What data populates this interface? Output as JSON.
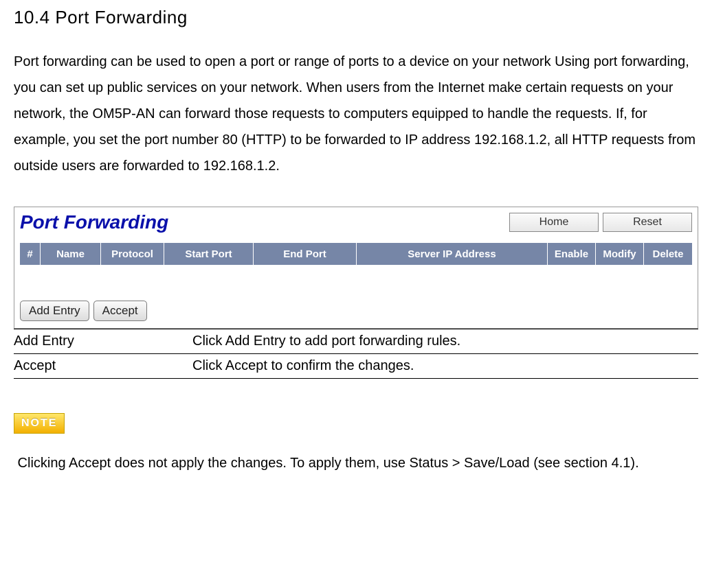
{
  "section_title": "10.4 Port Forwarding",
  "body": "Port forwarding can be used to open a port or range of ports to a device on your network Using port forwarding, you can set up public services on your network. When users from the Internet make certain requests on your network, the OM5P-AN can forward those requests to computers equipped to handle the requests. If, for example, you set the port number 80 (HTTP) to be forwarded to IP address 192.168.1.2, all HTTP requests from outside users are forwarded to 192.168.1.2.",
  "panel": {
    "title": "Port Forwarding",
    "buttons": {
      "home": "Home",
      "reset": "Reset"
    },
    "headers": {
      "num": "#",
      "name": "Name",
      "proto": "Protocol",
      "start": "Start Port",
      "end": "End Port",
      "ip": "Server IP Address",
      "enable": "Enable",
      "modify": "Modify",
      "delete": "Delete"
    },
    "action_buttons": {
      "add": "Add Entry",
      "accept": "Accept"
    }
  },
  "defs": [
    {
      "term": "Add Entry",
      "desc": "Click Add Entry to add port forwarding rules."
    },
    {
      "term": "Accept",
      "desc": "Click Accept to confirm the changes."
    }
  ],
  "note_label": "NOTE",
  "note_text": " Clicking Accept does not apply the changes. To apply them, use Status > Save/Load (see section 4.1)."
}
